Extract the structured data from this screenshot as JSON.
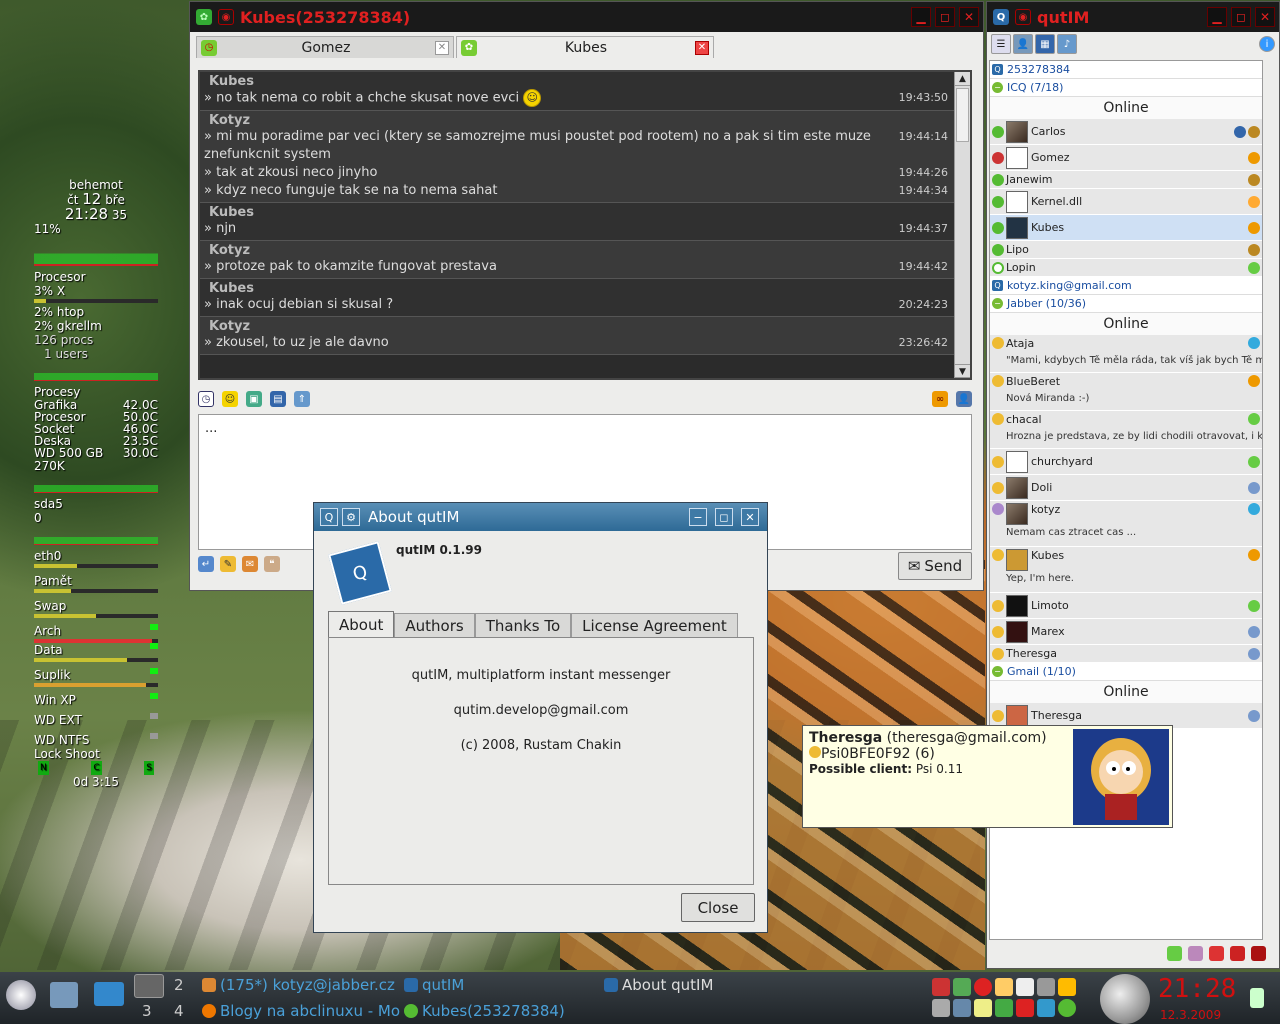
{
  "desktop": {
    "conky": {
      "host": "behemot",
      "day": "čt",
      "daynum": "12",
      "month": "bře",
      "time": "21:28",
      "sec": "35",
      "cpu_pct": "11%",
      "processor_label": "Procesor",
      "procs": [
        {
          "name": "3% X"
        },
        {
          "name": "2% htop"
        },
        {
          "name": "2% gkrellm"
        }
      ],
      "procs_count": "126 procs",
      "users": "1 users",
      "procesy_label": "Procesy",
      "temps": [
        {
          "label": "Grafika",
          "value": "42.0C"
        },
        {
          "label": "Procesor",
          "value": "50.0C"
        },
        {
          "label": "Socket",
          "value": "46.0C"
        },
        {
          "label": "Deska",
          "value": "23.5C"
        },
        {
          "label": "WD 500 GB",
          "value": "30.0C"
        }
      ],
      "net": "270K",
      "disk_label": "sda5",
      "disk_val": "0",
      "eth_label": "eth0",
      "mem_label": "Pamět",
      "swap_label": "Swap",
      "mounts": [
        {
          "label": "Arch",
          "fill": 0.95
        },
        {
          "label": "Data",
          "fill": 0.75
        },
        {
          "label": "Suplik",
          "fill": 0.9
        }
      ],
      "parts": [
        "Win XP",
        "WD EXT",
        "WD NTFS"
      ],
      "locks": "Lock  Shoot",
      "keys": [
        "N",
        "C",
        "S"
      ],
      "uptime": "0d  3:15"
    }
  },
  "chat": {
    "title": "Kubes(253278384)",
    "tabs": [
      {
        "label": "Gomez"
      },
      {
        "label": "Kubes"
      }
    ],
    "messages": [
      {
        "nick": "Kubes",
        "lines": [
          {
            "text": "» no tak nema co robit a chche skusat nove evci",
            "time": "19:43:50",
            "smile": true
          }
        ]
      },
      {
        "nick": "Kotyz",
        "lines": [
          {
            "text": "» mi mu poradime par veci (ktery se samozrejme musi poustet pod rootem) no a pak si tim este muze znefunkcnit system",
            "time": "19:44:14"
          },
          {
            "text": "» tak at zkousi neco jinyho",
            "time": "19:44:26"
          },
          {
            "text": "» kdyz neco funguje tak se na to nema sahat",
            "time": "19:44:34"
          }
        ]
      },
      {
        "nick": "Kubes",
        "lines": [
          {
            "text": "» njn",
            "time": "19:44:37"
          }
        ]
      },
      {
        "nick": "Kotyz",
        "lines": [
          {
            "text": "» protoze pak to okamzite fungovat prestava",
            "time": "19:44:42"
          }
        ]
      },
      {
        "nick": "Kubes",
        "lines": [
          {
            "text": "» inak ocuj debian si skusal ?",
            "time": "20:24:23"
          }
        ]
      },
      {
        "nick": "Kotyz",
        "lines": [
          {
            "text": "» zkousel, to uz je ale davno",
            "time": "23:26:42"
          }
        ]
      }
    ],
    "input_value": "...",
    "send_label": "Send"
  },
  "roster": {
    "title": "qutIM",
    "accounts": [
      {
        "id": "253278384",
        "group": "ICQ (7/18)",
        "status": "Online",
        "contacts": [
          {
            "name": "Carlos"
          },
          {
            "name": "Gomez"
          },
          {
            "name": "Janewim"
          },
          {
            "name": "Kernel.dll"
          },
          {
            "name": "Kubes",
            "selected": true
          },
          {
            "name": "Lipo"
          },
          {
            "name": "Lopin"
          }
        ]
      },
      {
        "id": "kotyz.king@gmail.com",
        "group": "Jabber (10/36)",
        "status": "Online",
        "contacts": [
          {
            "name": "Ataja",
            "sub": "\"Mami, kdybych Tě měla ráda, tak víš jak bych Tě měla ráda?"
          },
          {
            "name": "BlueBeret",
            "sub": "Nová Miranda :-)"
          },
          {
            "name": "chacal",
            "sub": "Hrozna je predstava, ze by lidi chodili otravovat, i kdyz nic ne"
          },
          {
            "name": "churchyard"
          },
          {
            "name": "Doli"
          },
          {
            "name": "kotyz",
            "sub": "Nemam cas ztracet cas ..."
          },
          {
            "name": "Kubes",
            "sub": "Yep, I'm here."
          },
          {
            "name": "Limoto"
          },
          {
            "name": "Marex"
          },
          {
            "name": "Theresga"
          }
        ]
      },
      {
        "id": "Gmail (1/10)",
        "status": "Online",
        "contacts": [
          {
            "name": "Theresga"
          }
        ]
      }
    ]
  },
  "tooltip": {
    "name": "Theresga",
    "jid": "(theresga@gmail.com)",
    "resource": "Psi0BFE0F92",
    "priority": "(6)",
    "client_label": "Possible client:",
    "client": "Psi 0.11"
  },
  "about": {
    "title": "About qutIM",
    "version": "qutIM 0.1.99",
    "tabs": [
      "About",
      "Authors",
      "Thanks To",
      "License Agreement"
    ],
    "line1": "qutIM, multiplatform instant messenger",
    "line2": "qutim.develop@gmail.com",
    "line3": "(c) 2008, Rustam Chakin",
    "close": "Close"
  },
  "taskbar": {
    "desktops": [
      "2",
      "3",
      "4"
    ],
    "tasks": [
      {
        "label": "(175*) kotyz@jabber.cz"
      },
      {
        "label": "qutIM"
      },
      {
        "label": "About qutIM"
      },
      {
        "label": "Blogy na abclinuxu - Mo"
      },
      {
        "label": "Kubes(253278384)"
      }
    ],
    "clock": "21:28",
    "date": "12.3.2009"
  }
}
